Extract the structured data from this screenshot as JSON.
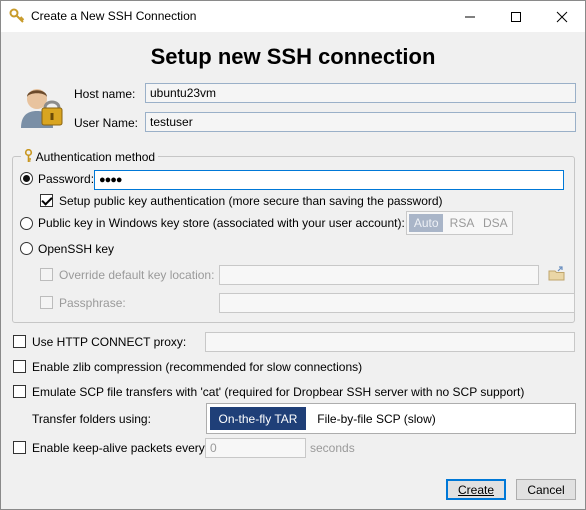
{
  "window": {
    "title": "Create a New SSH Connection",
    "minimize_icon": "minimize-icon",
    "maximize_icon": "maximize-icon",
    "close_icon": "close-icon"
  },
  "heading": "Setup new SSH connection",
  "host": {
    "label": "Host name:",
    "value": "ubuntu23vm"
  },
  "user": {
    "label": "User Name:",
    "value": "testuser"
  },
  "auth": {
    "legend": "Authentication method",
    "password_label": "Password:",
    "password_value": "●●●●",
    "setup_pubkey_label": "Setup public key authentication (more secure than saving the password)",
    "windows_store_label": "Public key in Windows key store (associated with your user account):",
    "key_types": [
      "Auto",
      "RSA",
      "DSA"
    ],
    "selected_key_type": "Auto",
    "openssh_label": "OpenSSH key",
    "override_label": "Override default key location:",
    "override_value": "",
    "passphrase_label": "Passphrase:",
    "passphrase_value": ""
  },
  "options": {
    "http_proxy_label": "Use HTTP CONNECT proxy:",
    "http_proxy_value": "",
    "zlib_label": "Enable zlib compression (recommended for slow connections)",
    "scp_cat_label": "Emulate SCP file transfers with 'cat' (required for Dropbear SSH server with no SCP support)",
    "transfer_label": "Transfer folders using:",
    "transfer_modes": [
      "On-the-fly TAR",
      "File-by-file SCP (slow)"
    ],
    "selected_transfer_mode": "On-the-fly TAR",
    "keepalive_label": "Enable keep-alive packets every:",
    "keepalive_value": "0",
    "keepalive_unit": "seconds"
  },
  "buttons": {
    "create": "Create",
    "cancel": "Cancel"
  },
  "colors": {
    "accent": "#1f3f78",
    "focus_border": "#0078d7"
  }
}
